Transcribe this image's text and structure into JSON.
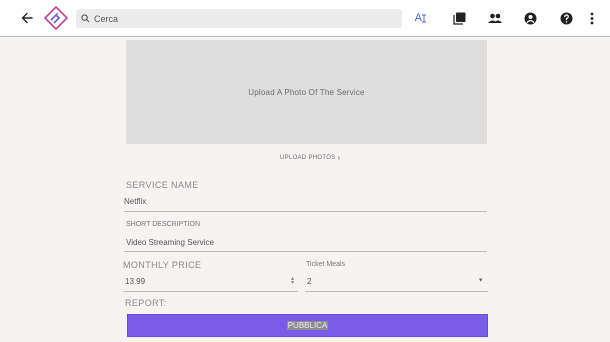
{
  "header": {
    "search_placeholder": "Cerca",
    "translate_label": "A",
    "icons": [
      "back-arrow-icon",
      "app-logo-icon",
      "search-icon",
      "translate-icon",
      "copy-icon",
      "people-icon",
      "account-icon",
      "help-icon",
      "more-vert-icon"
    ]
  },
  "upload": {
    "box_text": "Upload A Photo Of The Service",
    "link_text": "UPLOAD PHOTOS"
  },
  "form": {
    "service_name_label": "SERVICE NAME",
    "service_name_value": "Netflix",
    "short_description_label": "SHORT DESCRIPTION",
    "short_description_value": "Video Streaming Service",
    "monthly_price_label": "MONTHLY PRICE",
    "monthly_price_value": "13.99",
    "tickets_label": "Ticket Meals",
    "tickets_value": "2",
    "report_label": "REPORT:"
  },
  "actions": {
    "publish_label": "PUBBLICA"
  },
  "colors": {
    "accent": "#7b5ce8",
    "translate": "#4a5fd0",
    "background": "#f7f3f3"
  }
}
